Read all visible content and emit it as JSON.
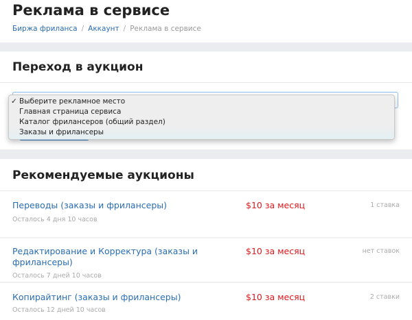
{
  "page": {
    "title": "Реклама в сервисе"
  },
  "breadcrumb": [
    {
      "label": "Биржа фриланса"
    },
    {
      "label": "Аккаунт"
    },
    {
      "label": "Реклама в сервисе"
    }
  ],
  "auction": {
    "title": "Переход в аукцион",
    "select": {
      "selected": "Выберите рекламное место",
      "options": [
        "Выберите рекламное место",
        "Главная страница сервиса",
        "Каталог фрилансеров (общий раздел)",
        "Заказы и фрилансеры"
      ]
    }
  },
  "recommended": {
    "title": "Рекомендуемые аукционы",
    "items": [
      {
        "title": "Переводы (заказы и фрилансеры)",
        "remaining": "Осталось 4 дня 10 часов",
        "price": "$10 за месяц",
        "bids": "1 ставка"
      },
      {
        "title": "Редактирование и Корректура (заказы и фрилансеры)",
        "remaining": "Осталось 7 дней 10 часов",
        "price": "$10 за месяц",
        "bids": "нет ставок"
      },
      {
        "title": "Копирайтинг (заказы и фрилансеры)",
        "remaining": "Осталось 12 дней 10 часов",
        "price": "$10 за месяц",
        "bids": "2 ставки"
      }
    ]
  }
}
